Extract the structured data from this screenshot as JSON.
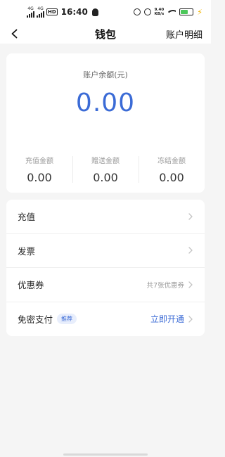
{
  "status_bar": {
    "net1": "4G",
    "net2": "4G",
    "hd": "HD",
    "time": "16:40",
    "speed_value": "9.40",
    "speed_unit": "KB/s"
  },
  "nav": {
    "title": "钱包",
    "right_link": "账户明细"
  },
  "balance": {
    "label": "账户余额(元)",
    "value": "0.00"
  },
  "stats": [
    {
      "label": "充值金额",
      "value": "0.00"
    },
    {
      "label": "赠送金额",
      "value": "0.00"
    },
    {
      "label": "冻结金额",
      "value": "0.00"
    }
  ],
  "menu": [
    {
      "label": "充值",
      "extra": ""
    },
    {
      "label": "发票",
      "extra": ""
    },
    {
      "label": "优惠券",
      "extra": "共7张优惠券"
    },
    {
      "label": "免密支付",
      "badge": "推荐",
      "extra": "立即开通"
    }
  ],
  "colors": {
    "accent": "#3b6bd6",
    "background": "#f5f5f5",
    "card": "#ffffff",
    "battery": "#4cc75a"
  },
  "icons": [
    "back-arrow-icon",
    "chevron-right-icon",
    "signal-icon",
    "wifi-icon",
    "battery-icon",
    "location-icon",
    "alarm-icon",
    "qq-icon",
    "charging-bolt-icon"
  ],
  "battery_level": 0.6
}
